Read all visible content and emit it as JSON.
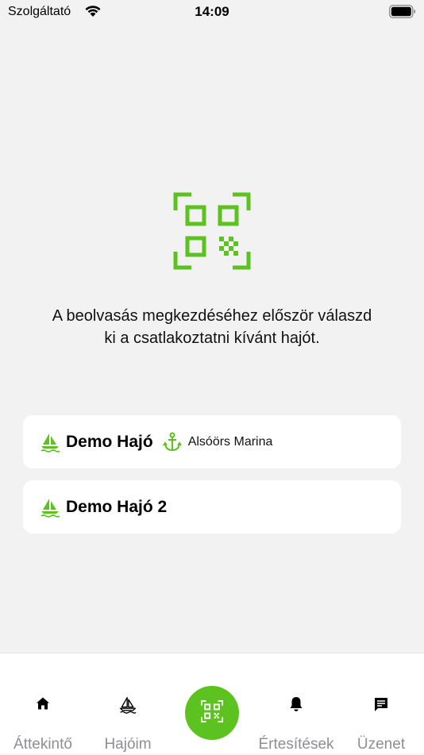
{
  "status_bar": {
    "carrier": "Szolgáltató",
    "time": "14:09"
  },
  "scan": {
    "instruction": "A beolvasás megkezdéséhez először válaszd ki a csatlakoztatni kívánt hajót."
  },
  "boats": [
    {
      "name": "Demo Hajó",
      "marina": "Alsóörs Marina",
      "icon": "sailboat-icon",
      "marina_icon": "anchor-icon"
    },
    {
      "name": "Demo Hajó 2",
      "icon": "sailboat-icon"
    }
  ],
  "tab_bar": {
    "items": [
      {
        "label": "Áttekintő",
        "icon": "home-icon"
      },
      {
        "label": "Hajóim",
        "icon": "sailboat-icon"
      },
      {
        "label": "",
        "icon": "qr-scan-icon"
      },
      {
        "label": "Értesítések",
        "icon": "bell-icon"
      },
      {
        "label": "Üzenet",
        "icon": "message-icon"
      }
    ]
  },
  "colors": {
    "accent": "#5cc21f",
    "background": "#f2f2f2",
    "card": "#ffffff",
    "tab_label": "#8e8e93"
  }
}
